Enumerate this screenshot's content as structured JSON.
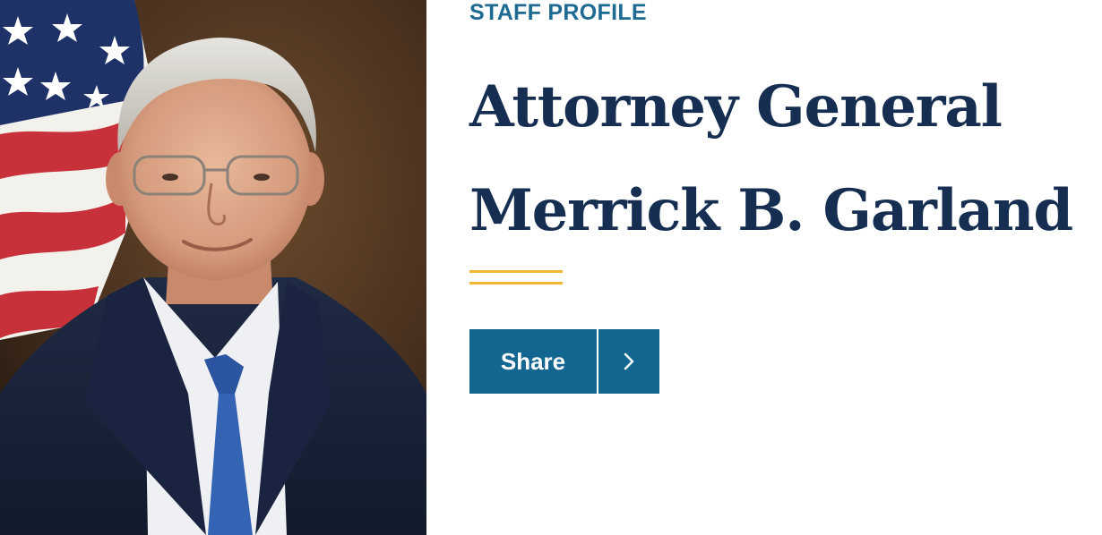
{
  "profile": {
    "eyebrow": "STAFF PROFILE",
    "title_line1": "Attorney General",
    "title_line2": "Merrick B. Garland"
  },
  "share_button": {
    "label": "Share",
    "icon": "chevron-right-icon"
  },
  "colors": {
    "eyebrow": "#1f6a92",
    "title": "#162e51",
    "accent": "#f2b534",
    "button": "#136690"
  }
}
